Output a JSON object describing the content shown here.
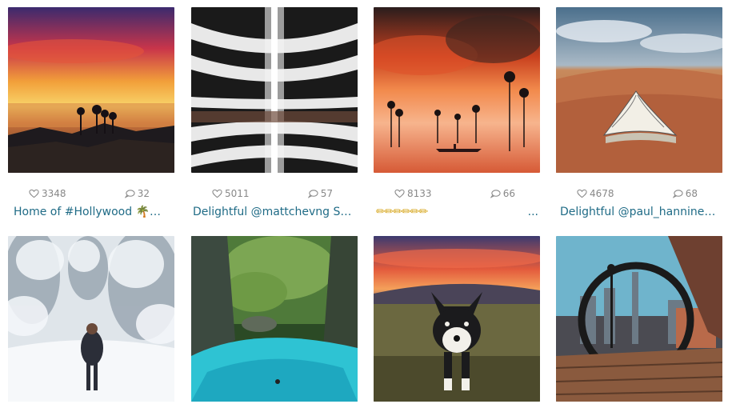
{
  "posts": [
    {
      "likes": "3348",
      "comments": "32",
      "caption": "Home of #Hollywood 🌴🌴 vi...",
      "scene": "sunset-city"
    },
    {
      "likes": "5011",
      "comments": "57",
      "caption": "Delightful @mattchevng Selec...",
      "scene": "atrium"
    },
    {
      "likes": "8133",
      "comments": "66",
      "caption": "✏✏✏✏✏✏",
      "trail": "...",
      "scene": "red-sky-lake"
    },
    {
      "likes": "4678",
      "comments": "68",
      "caption": "Delightful @paul_hanninen S...",
      "scene": "desert-book"
    },
    {
      "scene": "snow-forest"
    },
    {
      "scene": "turquoise-canyon"
    },
    {
      "scene": "husky-sunset"
    },
    {
      "scene": "bench-circle-city"
    }
  ],
  "icons": {
    "like": "heart-icon",
    "comment": "comment-bubble-icon"
  }
}
